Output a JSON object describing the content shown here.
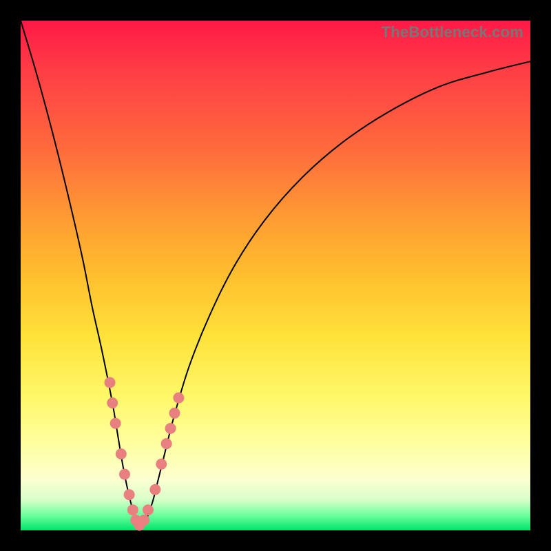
{
  "watermark": "TheBottleneck.com",
  "colors": {
    "frame": "#000000",
    "curve": "#000000",
    "marker": "#e98080",
    "gradient_top": "#ff1a47",
    "gradient_bottom": "#00e56a"
  },
  "chart_data": {
    "type": "line",
    "title": "",
    "xlabel": "",
    "ylabel": "",
    "xlim": [
      0,
      100
    ],
    "ylim": [
      0,
      100
    ],
    "curve": {
      "note": "V-shaped bottleneck curve; y is severity (100=top/red, 0=bottom/green). Minimum near x≈23.",
      "x": [
        0,
        3,
        6,
        9,
        12,
        14,
        16,
        18,
        19,
        20,
        21,
        22,
        23,
        24,
        25,
        26,
        27,
        28,
        30,
        33,
        37,
        42,
        48,
        55,
        63,
        72,
        82,
        92,
        100
      ],
      "y": [
        100,
        90,
        79,
        67,
        54,
        44,
        35,
        25,
        19,
        13,
        8,
        4,
        1,
        1,
        3,
        6,
        10,
        14,
        22,
        32,
        42,
        52,
        61,
        69,
        76,
        82,
        87,
        90,
        92
      ]
    },
    "markers": {
      "note": "salmon dots clustered around the trough on both arms",
      "points": [
        {
          "x": 17.5,
          "y": 29
        },
        {
          "x": 18.0,
          "y": 25
        },
        {
          "x": 18.6,
          "y": 21
        },
        {
          "x": 19.7,
          "y": 15
        },
        {
          "x": 20.4,
          "y": 11
        },
        {
          "x": 21.3,
          "y": 7
        },
        {
          "x": 22.0,
          "y": 4
        },
        {
          "x": 22.6,
          "y": 2
        },
        {
          "x": 23.3,
          "y": 1
        },
        {
          "x": 24.2,
          "y": 2
        },
        {
          "x": 25.0,
          "y": 4
        },
        {
          "x": 26.4,
          "y": 8
        },
        {
          "x": 27.6,
          "y": 13
        },
        {
          "x": 28.6,
          "y": 17
        },
        {
          "x": 29.4,
          "y": 20
        },
        {
          "x": 30.2,
          "y": 23
        },
        {
          "x": 31.0,
          "y": 26
        }
      ]
    }
  }
}
